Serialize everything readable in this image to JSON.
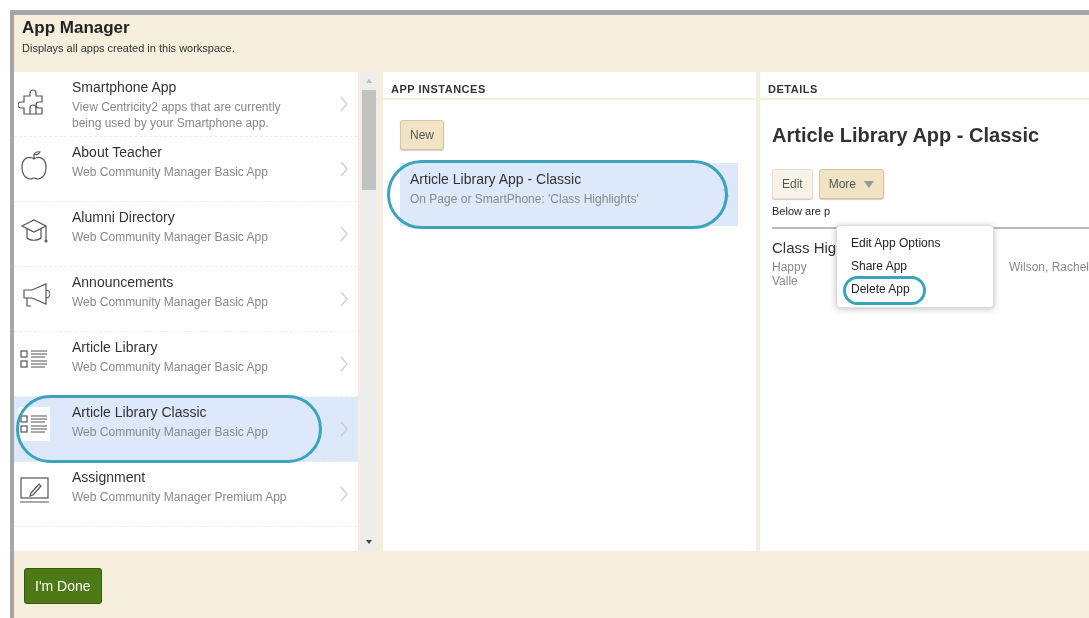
{
  "header": {
    "title": "App Manager",
    "subtitle": "Displays all apps created in this workspace."
  },
  "apps": [
    {
      "kind": "puzzle",
      "title": "Smartphone App",
      "subtitle": "View Centricity2 apps that are currently being used by your Smartphone app.",
      "selected": false,
      "circled": false
    },
    {
      "kind": "apple",
      "title": "About Teacher",
      "subtitle": "Web Community Manager Basic App",
      "selected": false,
      "circled": false
    },
    {
      "kind": "cap",
      "title": "Alumni Directory",
      "subtitle": "Web Community Manager Basic App",
      "selected": false,
      "circled": false
    },
    {
      "kind": "megaphone",
      "title": "Announcements",
      "subtitle": "Web Community Manager Basic App",
      "selected": false,
      "circled": false
    },
    {
      "kind": "list",
      "title": "Article Library",
      "subtitle": "Web Community Manager Basic App",
      "selected": false,
      "circled": false
    },
    {
      "kind": "list",
      "title": "Article Library Classic",
      "subtitle": "Web Community Manager Basic App",
      "selected": true,
      "circled": true
    },
    {
      "kind": "pencil",
      "title": "Assignment",
      "subtitle": "Web Community Manager Premium App",
      "selected": false,
      "circled": false
    }
  ],
  "instances": {
    "heading": "APP INSTANCES",
    "new_button": "New",
    "items": [
      {
        "title": "Article Library App - Classic",
        "subtitle": "On Page or SmartPhone: 'Class Highlights'",
        "selected": true,
        "circled": true
      }
    ]
  },
  "details": {
    "heading": "DETAILS",
    "title": "Article Library App - Classic",
    "edit_button": "Edit",
    "more_button": "More",
    "note": "Below are p",
    "pages": [
      {
        "title": "Class Hig",
        "path_left": "Happy Valle",
        "path_right": "Wilson, Rachel"
      }
    ],
    "menu": [
      {
        "label": "Edit App Options",
        "circled": false
      },
      {
        "label": "Share App",
        "circled": false
      },
      {
        "label": "Delete App",
        "circled": true
      }
    ]
  },
  "done_button": "I'm Done"
}
